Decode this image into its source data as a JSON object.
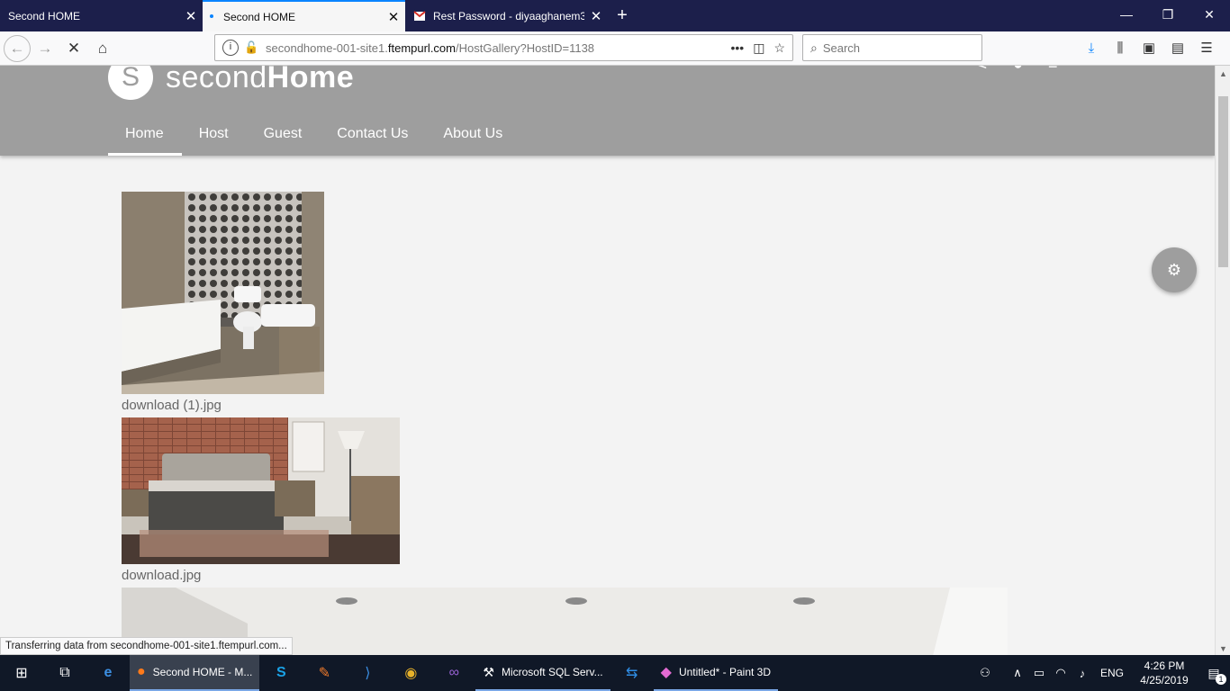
{
  "browser": {
    "tabs": [
      {
        "title": "Second HOME",
        "active": false
      },
      {
        "title": "Second HOME",
        "active": true
      },
      {
        "title": "Rest Password - diyaaghanem3",
        "active": false
      }
    ],
    "url": {
      "host_prefix": "secondhome-001-site1.",
      "domain": "ftempurl.com",
      "path": "/HostGallery?HostID=1138"
    },
    "search_placeholder": "Search",
    "status_text": "Transferring data from secondhome-001-site1.ftempurl.com..."
  },
  "site": {
    "logo_letter": "S",
    "logo_light": "second",
    "logo_bold": "Home",
    "menu": [
      {
        "label": "Home",
        "active": true
      },
      {
        "label": "Host",
        "active": false
      },
      {
        "label": "Guest",
        "active": false
      },
      {
        "label": "Contact Us",
        "active": false
      },
      {
        "label": "About Us",
        "active": false
      }
    ]
  },
  "gallery": [
    {
      "caption": "download (1).jpg"
    },
    {
      "caption": "download.jpg"
    }
  ],
  "taskbar": {
    "apps": [
      {
        "label": "Second HOME - M..."
      },
      {
        "label": "Microsoft SQL Serv..."
      },
      {
        "label": "Untitled* - Paint 3D"
      }
    ],
    "language": "ENG",
    "time": "4:26 PM",
    "date": "4/25/2019",
    "notification_count": "1"
  }
}
